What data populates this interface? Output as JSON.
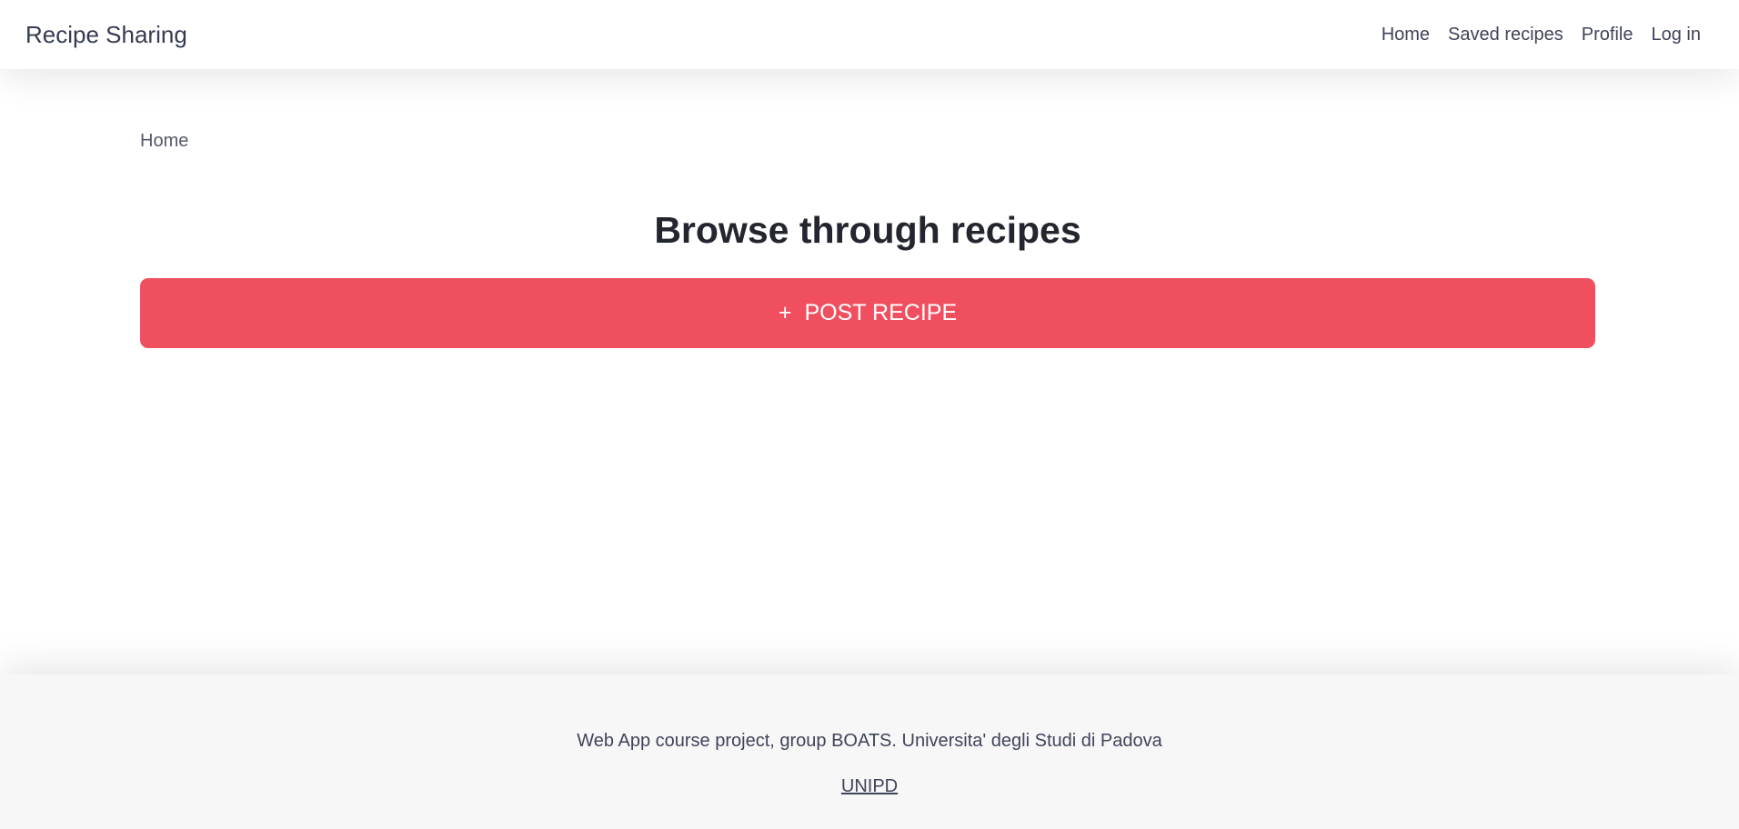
{
  "navbar": {
    "brand": "Recipe Sharing",
    "links": [
      "Home",
      "Saved recipes",
      "Profile",
      "Log in"
    ]
  },
  "breadcrumb": {
    "current": "Home"
  },
  "main": {
    "title": "Browse through recipes",
    "post_button_label": "POST RECIPE",
    "post_button_icon": "+"
  },
  "footer": {
    "text": "Web App course project, group BOATS. Universita' degli Studi di Padova",
    "link_label": "UNIPD"
  },
  "colors": {
    "accent": "#f04f60",
    "footer_bg": "#f7f7f8"
  }
}
